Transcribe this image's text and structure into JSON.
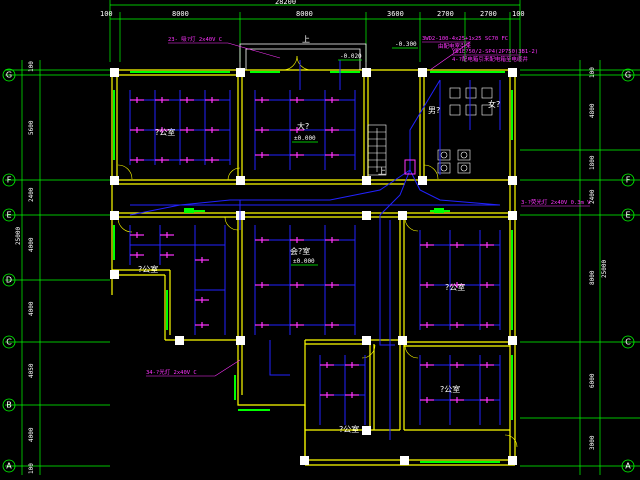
{
  "drawing": {
    "top_dims": {
      "total": "28200",
      "segments": [
        "100",
        "8000",
        "8000",
        "3600",
        "2700",
        "2700",
        "100"
      ]
    },
    "left_dims": {
      "total": "25000",
      "segments": [
        "100",
        "5600",
        "2400",
        "4000",
        "4000",
        "4050",
        "4000",
        "100"
      ]
    },
    "right_dims": {
      "total": "25000",
      "segments": [
        "100",
        "4800",
        "1800",
        "2400",
        "8000",
        "6000",
        "3000",
        "100"
      ]
    },
    "axes": [
      "G",
      "F",
      "E",
      "D",
      "C",
      "B",
      "A"
    ],
    "rooms": {
      "office_tl": "?公室",
      "hall": "大?",
      "office_left": "?公室",
      "meeting": "会?室",
      "office_r1": "?公室",
      "office_r2": "?公室",
      "office_bottom": "?公室",
      "toilet_m": "男?",
      "toilet_f": "女?"
    },
    "levels": {
      "hall": "±0.000",
      "meeting": "±0.000",
      "entrance": "-0.020",
      "top_right": "-0.300"
    },
    "labels": {
      "up": "上",
      "entrance_up": "上"
    },
    "notes": {
      "top_left": "23-  吸?灯 2x40V C",
      "top_center": "3WD2-100-4x25+1x25  SC70  FC",
      "top_center2": "由配电室引来",
      "top_right": "YB1E?50/2-SP4(2P750)3B1-2)",
      "top_right2": "4-?配电箱引来配电箱至电缆井",
      "right": "3-?荧光灯 2x40V  0.3m  V",
      "bottom_left": "34-?光灯 2x40V  C"
    }
  }
}
